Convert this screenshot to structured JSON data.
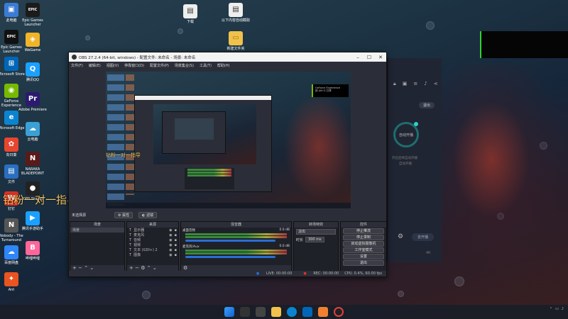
{
  "desktop": {
    "icons_left": [
      {
        "label": "此电脑",
        "color": "#3a7bd5",
        "glyph": "▣"
      },
      {
        "label": "Epic Games Launcher",
        "color": "#111",
        "glyph": "EPIC"
      },
      {
        "label": "Microsoft Store",
        "color": "#0067b8",
        "glyph": "⊞"
      },
      {
        "label": "GeForce Experience",
        "color": "#76b900",
        "glyph": "◉"
      },
      {
        "label": "Microsoft Edge",
        "color": "#0a84d0",
        "glyph": "e"
      },
      {
        "label": "向日葵",
        "color": "#e8452f",
        "glyph": "✿"
      },
      {
        "label": "文件",
        "color": "#2a6fbf",
        "glyph": "▤"
      },
      {
        "label": "钉钉",
        "color": "#d93025",
        "glyph": "W"
      },
      {
        "label": "Nobody - The Turnaround",
        "color": "#555",
        "glyph": "N"
      },
      {
        "label": "百度网盘",
        "color": "#2f86f6",
        "glyph": "☁"
      },
      {
        "label": "Ant",
        "color": "#e95420",
        "glyph": "✦"
      }
    ],
    "icons_col2": [
      {
        "label": "Epic Games Launcher",
        "color": "#1b1b1b",
        "glyph": "EPIC"
      },
      {
        "label": "WeGame",
        "color": "#f0b429",
        "glyph": "◈"
      },
      {
        "label": "腾讯QQ",
        "color": "#1aa0ff",
        "glyph": "Q"
      },
      {
        "label": "Adobe Premiere",
        "color": "#2b1a6e",
        "glyph": "Pr"
      },
      {
        "label": "云电脑",
        "color": "#3aa0d5",
        "glyph": "☁"
      },
      {
        "label": "NARAKA BLADEPOINT",
        "color": "#5a1a1a",
        "glyph": "N"
      },
      {
        "label": "OBS Studio",
        "color": "#222",
        "glyph": "●"
      },
      {
        "label": "腾讯手游助手",
        "color": "#1aa0ff",
        "glyph": "▶"
      },
      {
        "label": "哔哩哔哩",
        "color": "#ff6699",
        "glyph": "B"
      }
    ],
    "top_files": [
      {
        "label": "下载"
      },
      {
        "label": "以下内容自动截取"
      },
      {
        "label": "新建文件夹"
      }
    ],
    "overlay_text": "钻粉一对一指导",
    "overlay_text_small": "钻粉一对一指导"
  },
  "obs": {
    "title": "OBS 27.2.4 (64-bit, windows) - 配置文件: 未命名 - 场景: 未命名",
    "menu": [
      "文件(F)",
      "编辑(E)",
      "视图(V)",
      "停靠窗口(D)",
      "配置文件(P)",
      "场景集合(S)",
      "工具(T)",
      "帮助(H)"
    ],
    "scene_label": "未选择源",
    "properties_btn": "属性",
    "filters_btn": "滤镜",
    "docks": {
      "scenes": {
        "title": "场景",
        "items": [
          "场景"
        ]
      },
      "sources": {
        "title": "来源",
        "items": [
          "显示器",
          "麦克风",
          "音频",
          "视频",
          "文本 (GDI+) 2",
          "图像"
        ]
      },
      "mixer": {
        "title": "混音器",
        "channels": [
          {
            "name": "桌面音频",
            "db": "0.0 dB"
          },
          {
            "name": "麦克风/Aux",
            "db": "0.0 dB"
          }
        ]
      },
      "transitions": {
        "title": "转场特效",
        "type": "淡出",
        "duration_label": "时长",
        "duration": "300 ms"
      },
      "controls": {
        "title": "控件",
        "buttons": [
          "停止推流",
          "停止录制",
          "启动虚拟摄像机",
          "工作室模式",
          "设置",
          "退出"
        ]
      }
    },
    "status": {
      "live": "LIVE: 00:00:00",
      "rec": "REC: 00:00:00",
      "cpu": "CPU: 0.4%, 60.00 fps"
    }
  },
  "right_panel": {
    "btn_exit": "退出",
    "circle_label": "自动开播",
    "hint": "开启后将自动开播",
    "hint2": "自动开播",
    "btn_start": "去开播",
    "chip": "4K"
  },
  "preview_overlay": {
    "badge_line1": "GeForce Experience",
    "badge_line2": "按 Alt+Z 共享"
  },
  "taskbar": {
    "time": "",
    "date": ""
  }
}
